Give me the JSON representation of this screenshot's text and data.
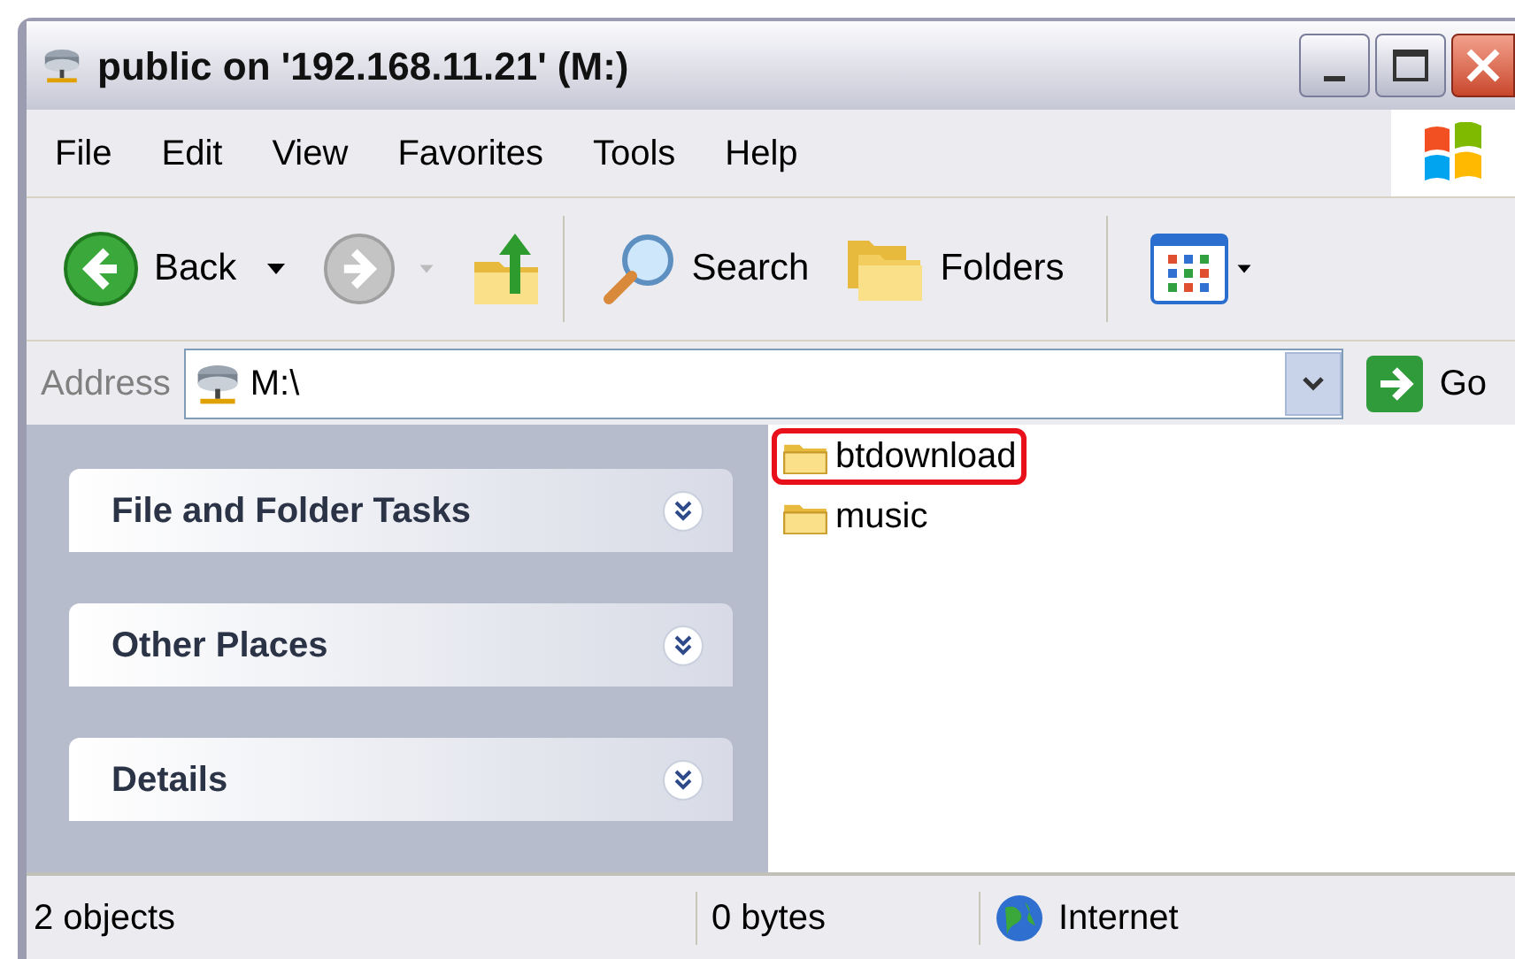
{
  "window": {
    "title": "public on '192.168.11.21' (M:)"
  },
  "menu": [
    "File",
    "Edit",
    "View",
    "Favorites",
    "Tools",
    "Help"
  ],
  "toolbar": [
    {
      "kind": "back",
      "label": "Back",
      "disabled": false
    },
    {
      "kind": "forward",
      "disabled": true
    },
    {
      "kind": "up"
    },
    {
      "kind": "search",
      "label": "Search"
    },
    {
      "kind": "folders",
      "label": "Folders"
    },
    {
      "kind": "views"
    }
  ],
  "address": {
    "label": "Address",
    "value": "M:\\",
    "go": "Go"
  },
  "task_panes": [
    {
      "title": "File and Folder Tasks",
      "expanded": false
    },
    {
      "title": "Other Places",
      "expanded": false
    },
    {
      "title": "Details",
      "expanded": false
    }
  ],
  "items": [
    {
      "name": "btdownload",
      "highlighted": true
    },
    {
      "name": "music",
      "highlighted": false
    }
  ],
  "status_bar": {
    "objects": "2 objects",
    "size": "0 bytes",
    "zone": "Internet"
  }
}
